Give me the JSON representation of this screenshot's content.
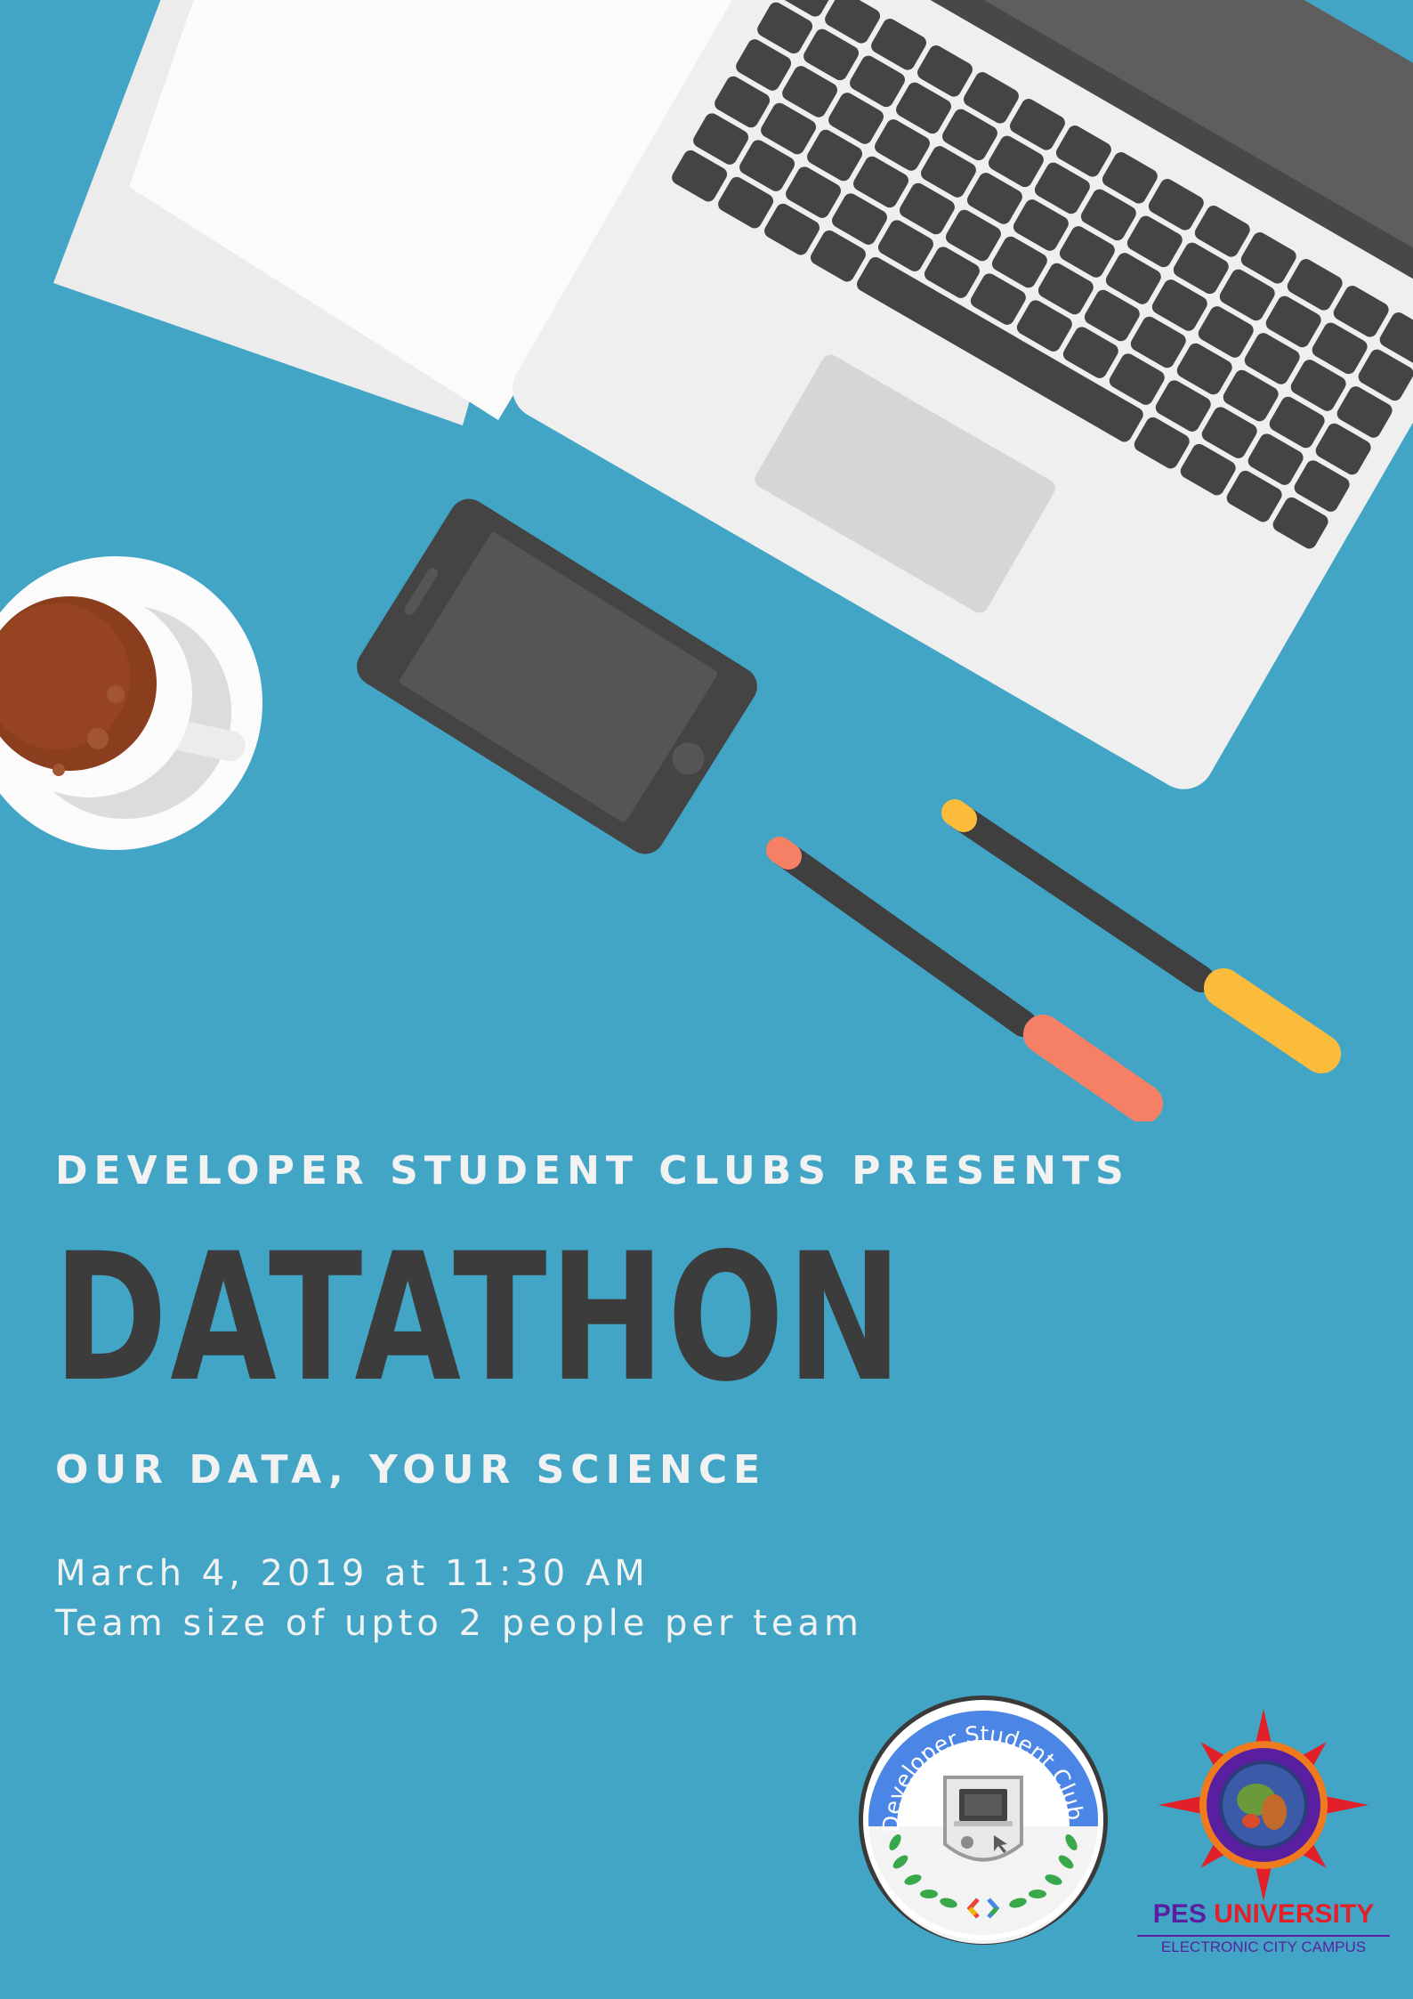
{
  "poster": {
    "presenter_line": "DEVELOPER STUDENT CLUBS PRESENTS",
    "title": "DATATHON",
    "tagline": "OUR DATA, YOUR SCIENCE",
    "date_time": "March 4, 2019 at 11:30 AM",
    "team_size": "Team size of upto 2 people per team"
  },
  "logos": {
    "dsc_ring_text": "Developer Student Clubs",
    "pes_name_part1": "PES",
    "pes_name_part2": "UNIVERSITY",
    "pes_campus": "ELECTRONIC CITY CAMPUS"
  },
  "illustration": {
    "items": [
      "paper-sheets",
      "laptop",
      "smartphone",
      "coffee-cup",
      "marker-red",
      "marker-yellow"
    ]
  },
  "colors": {
    "background": "#42a5c5",
    "title_text": "#3c3c3c",
    "light_text": "#f2f2f2",
    "coffee": "#8b3e1d",
    "marker_red": "#f58066",
    "marker_yellow": "#fbbc3c",
    "pes_purple": "#5a1fa0",
    "pes_red": "#e2202a"
  }
}
